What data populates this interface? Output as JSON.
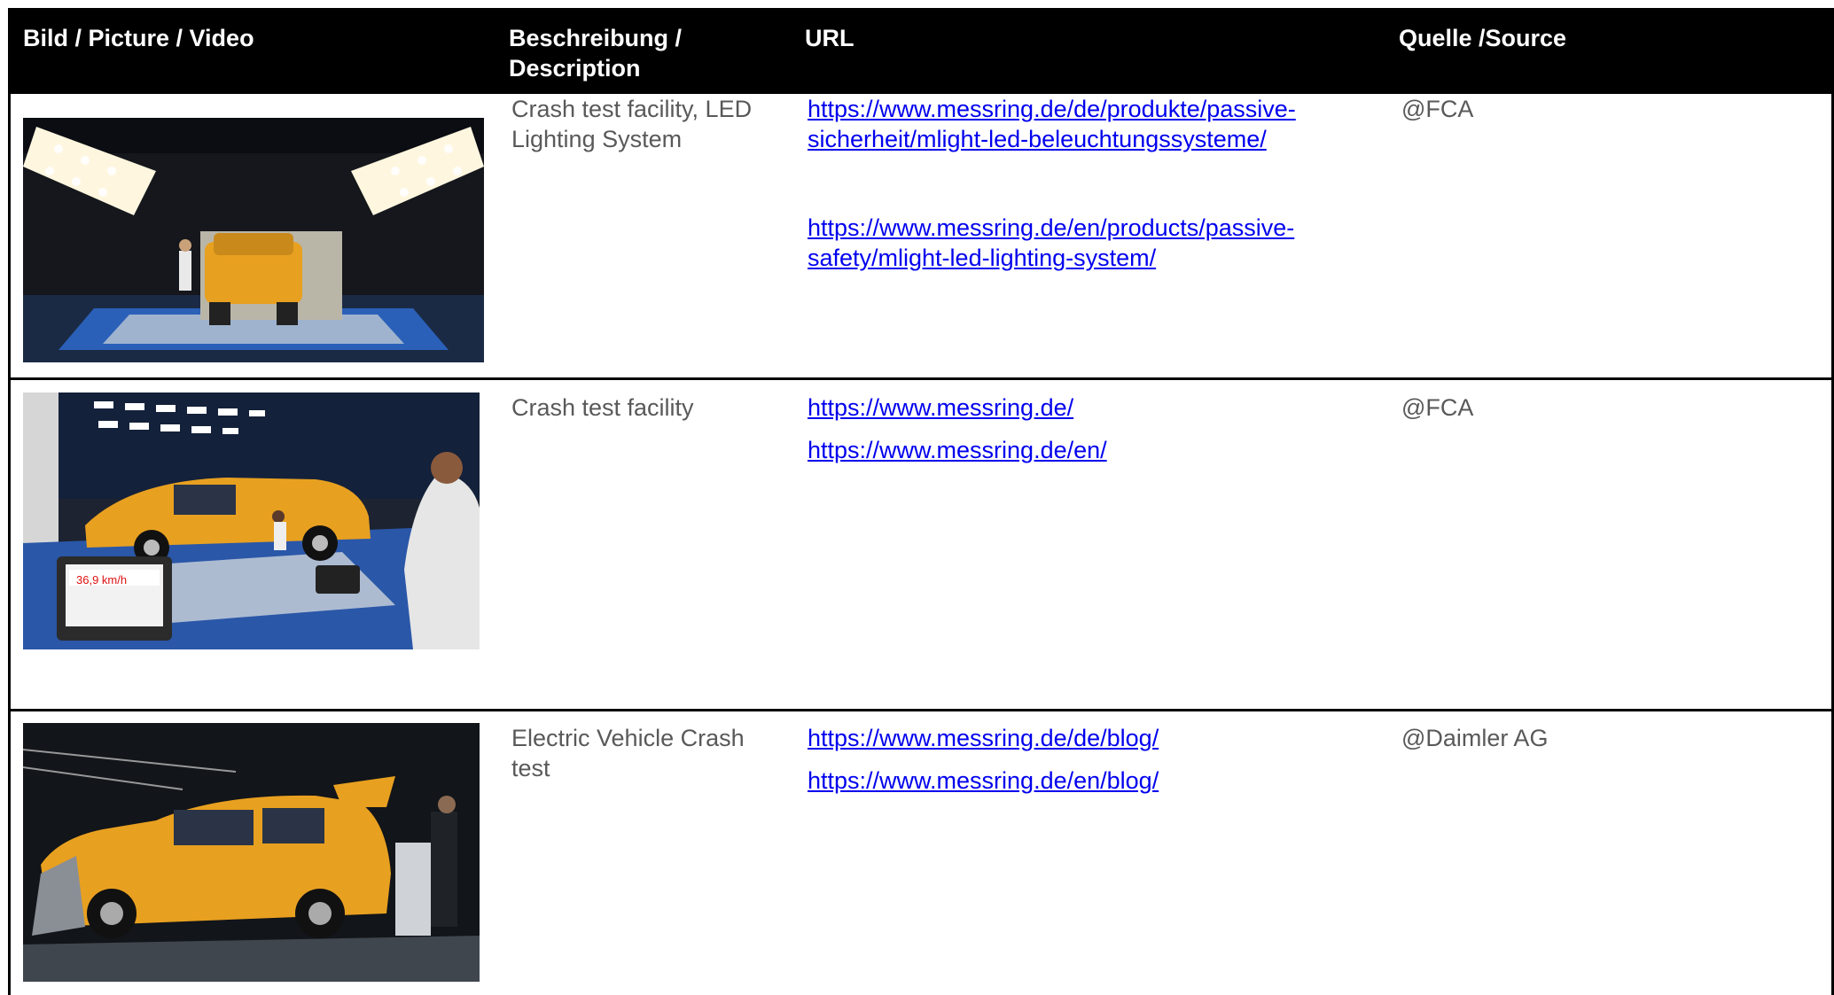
{
  "headers": {
    "picture": "Bild / Picture / Video",
    "description_l1": "Beschreibung /",
    "description_l2": "Description",
    "url": "URL",
    "source": "Quelle /Source"
  },
  "rows": [
    {
      "description_l1": "Crash test facility, LED",
      "description_l2": "Lighting System",
      "links": [
        {
          "l1": "https://www.messring.de/de/produkte/passive-",
          "l2": "sicherheit/mlight-led-beleuchtungssysteme/"
        },
        {
          "l1": "https://www.messring.de/en/products/passive-",
          "l2": "safety/mlight-led-lighting-system/"
        }
      ],
      "source": "@FCA"
    },
    {
      "description_l1": "Crash test facility",
      "links": [
        {
          "l1": "https://www.messring.de/"
        },
        {
          "l1": "https://www.messring.de/en/"
        }
      ],
      "source": "@FCA",
      "photo_readout": "36,9 km/h"
    },
    {
      "description_l1": "Electric Vehicle Crash",
      "description_l2": "test",
      "links": [
        {
          "l1": "https://www.messring.de/de/blog/"
        },
        {
          "l1": "https://www.messring.de/en/blog/"
        }
      ],
      "source": "@Daimler AG"
    }
  ],
  "colors": {
    "header_bg": "#000000",
    "header_text": "#ffffff",
    "body_text": "#595959",
    "link": "#0000ee",
    "car": "#e8a020"
  }
}
